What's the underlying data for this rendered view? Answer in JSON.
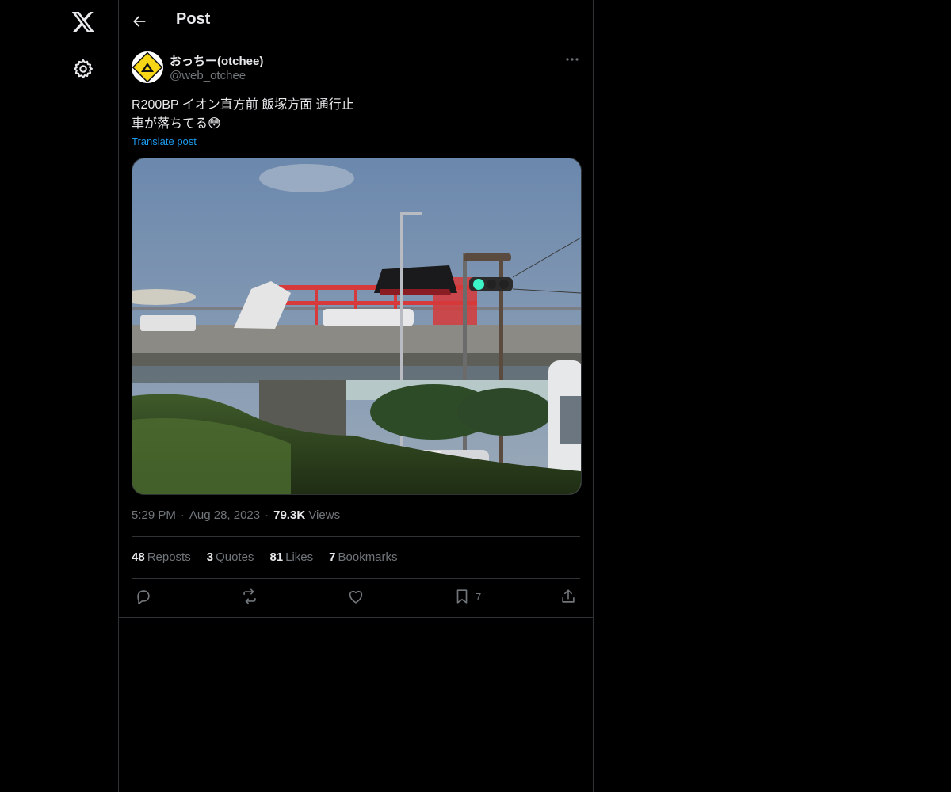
{
  "nav": {
    "logo_icon": "x-logo-icon",
    "settings_icon": "gear-icon"
  },
  "header": {
    "back_icon": "arrow-left-icon",
    "title": "Post"
  },
  "post": {
    "author_name": "おっちー(otchee)",
    "author_handle": "@web_otchee",
    "text": "R200BP イオン直方前 飯塚方面 通行止\n車が落ちてる😳",
    "translate_label": "Translate post",
    "media_icon": "photo",
    "time": "5:29 PM",
    "date": "Aug 28, 2023",
    "views_count": "79.3K",
    "views_label": "Views"
  },
  "stats": [
    {
      "count": "48",
      "label": "Reposts"
    },
    {
      "count": "3",
      "label": "Quotes"
    },
    {
      "count": "81",
      "label": "Likes"
    },
    {
      "count": "7",
      "label": "Bookmarks"
    }
  ],
  "actions": {
    "reply_icon": "reply-icon",
    "repost_icon": "repost-icon",
    "like_icon": "heart-icon",
    "bookmark_icon": "bookmark-icon",
    "bookmark_count": "7",
    "share_icon": "share-icon"
  },
  "colors": {
    "background": "#000000",
    "text": "#e7e9ea",
    "secondary": "#71767b",
    "accent": "#1d9bf0",
    "border": "#2f3336"
  }
}
